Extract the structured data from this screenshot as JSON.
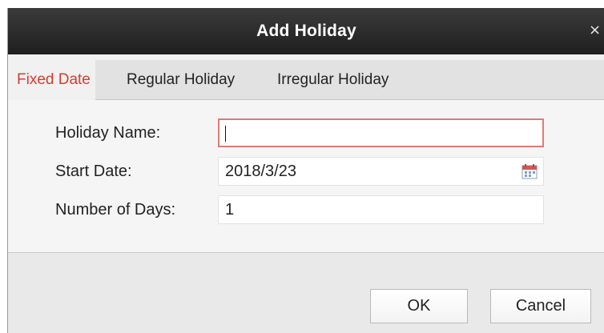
{
  "dialog": {
    "title": "Add Holiday",
    "close_glyph": "×"
  },
  "tabs": [
    {
      "label": "Fixed Date",
      "active": true
    },
    {
      "label": "Regular Holiday",
      "active": false
    },
    {
      "label": "Irregular Holiday",
      "active": false
    }
  ],
  "form": {
    "holiday_name": {
      "label": "Holiday Name:",
      "value": ""
    },
    "start_date": {
      "label": "Start Date:",
      "value": "2018/3/23",
      "icon": "calendar-icon"
    },
    "number_of_days": {
      "label": "Number of Days:",
      "value": "1"
    }
  },
  "buttons": {
    "ok_label": "OK",
    "cancel_label": "Cancel"
  },
  "colors": {
    "active_tab": "#d63b2f",
    "focus_border": "#e07a74",
    "titlebar": "#2a2a2a"
  }
}
